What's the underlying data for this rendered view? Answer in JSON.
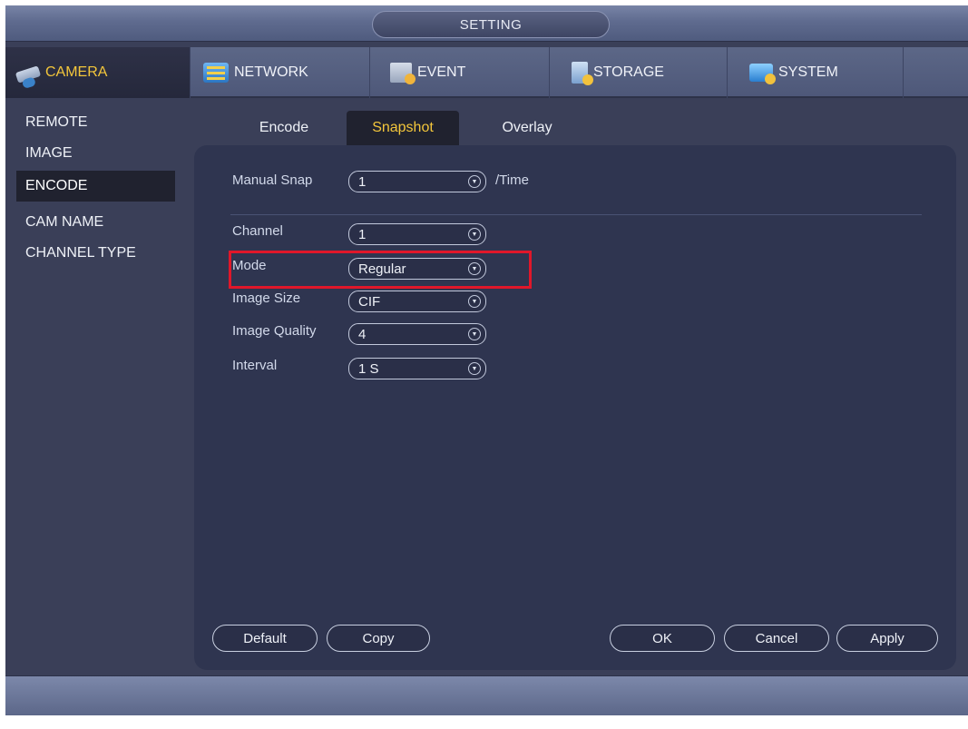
{
  "title": "SETTING",
  "menu": [
    {
      "label": "CAMERA",
      "icon": "camera-icon",
      "active": true
    },
    {
      "label": "NETWORK",
      "icon": "network-icon",
      "active": false
    },
    {
      "label": "EVENT",
      "icon": "event-icon",
      "active": false
    },
    {
      "label": "STORAGE",
      "icon": "storage-icon",
      "active": false
    },
    {
      "label": "SYSTEM",
      "icon": "system-icon",
      "active": false
    }
  ],
  "sidebar": [
    {
      "label": "REMOTE",
      "active": false
    },
    {
      "label": "IMAGE",
      "active": false
    },
    {
      "label": "ENCODE",
      "active": true
    },
    {
      "label": "CAM NAME",
      "active": false
    },
    {
      "label": "CHANNEL TYPE",
      "active": false
    }
  ],
  "subtabs": [
    {
      "label": "Encode",
      "active": false
    },
    {
      "label": "Snapshot",
      "active": true
    },
    {
      "label": "Overlay",
      "active": false
    }
  ],
  "form": {
    "manual_snap": {
      "label": "Manual Snap",
      "value": "1",
      "suffix": "/Time"
    },
    "channel": {
      "label": "Channel",
      "value": "1"
    },
    "mode": {
      "label": "Mode",
      "value": "Regular"
    },
    "image_size": {
      "label": "Image Size",
      "value": "CIF"
    },
    "image_quality": {
      "label": "Image Quality",
      "value": "4"
    },
    "interval": {
      "label": "Interval",
      "value": "1 S"
    }
  },
  "buttons": {
    "default": "Default",
    "copy": "Copy",
    "ok": "OK",
    "cancel": "Cancel",
    "apply": "Apply"
  },
  "colors": {
    "active_text": "#f3c63b",
    "highlight_box": "#e0172a"
  }
}
